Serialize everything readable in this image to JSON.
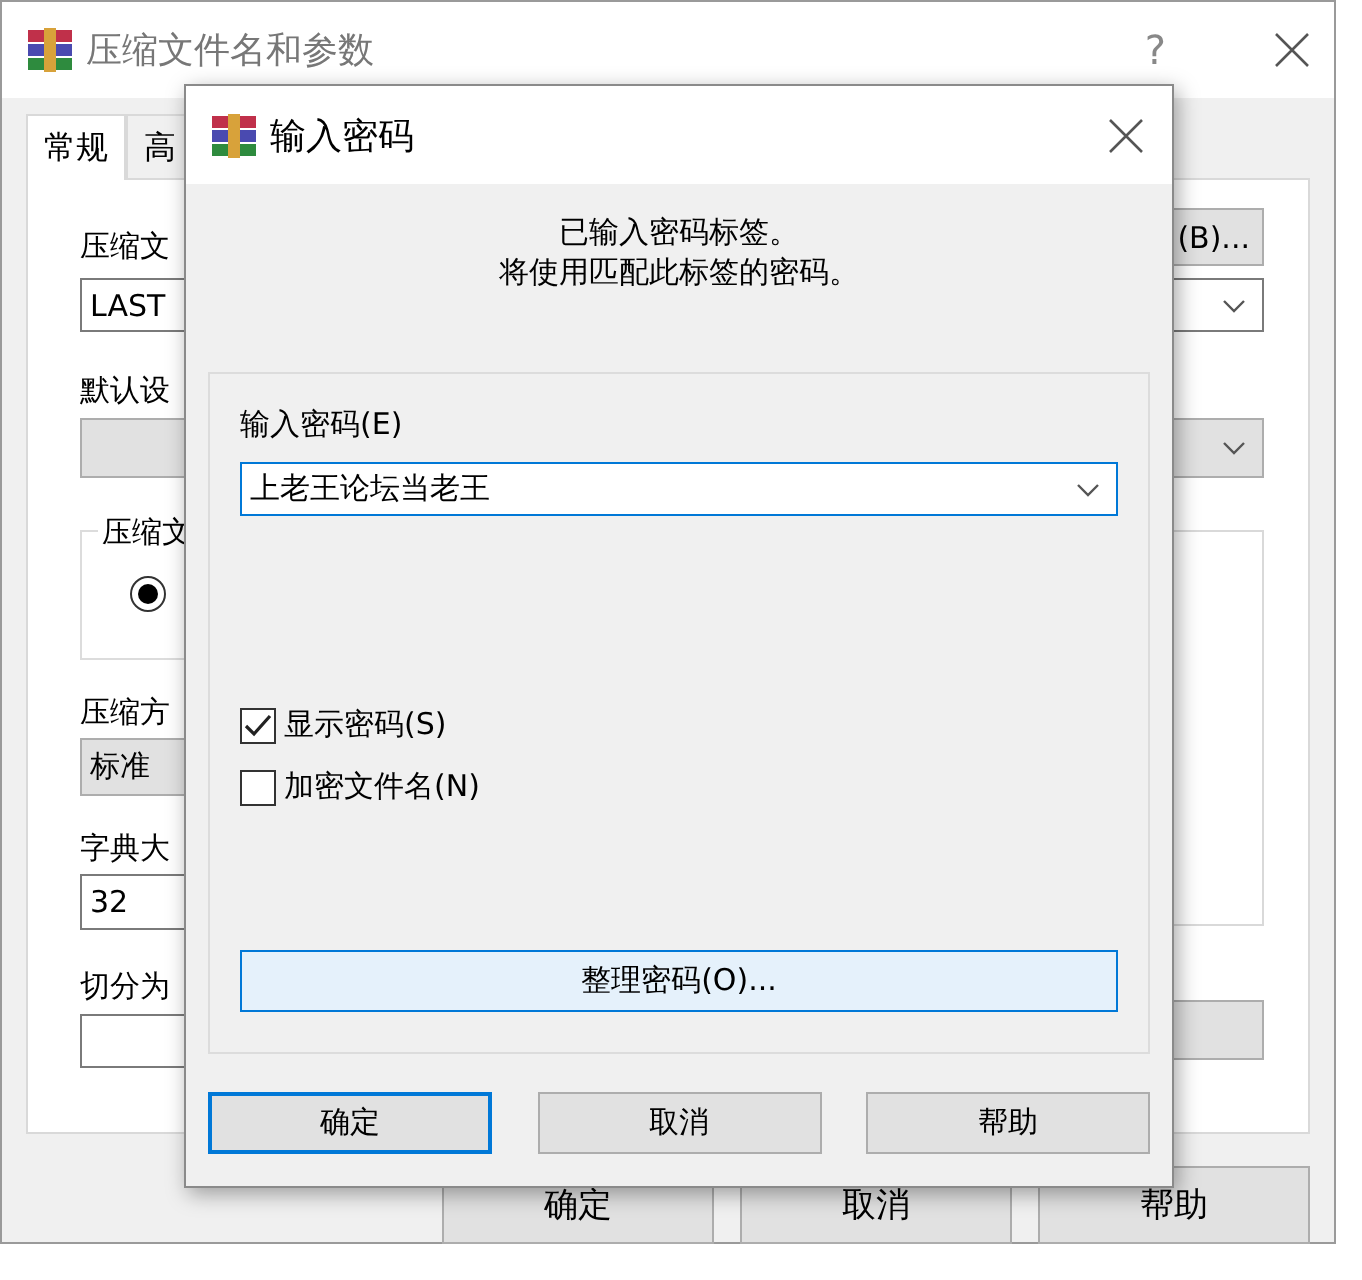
{
  "background_window": {
    "title": "压缩文件名和参数",
    "help_button": "?",
    "tabs": [
      {
        "label": "常规",
        "selected": true
      },
      {
        "label": "高",
        "selected": false
      }
    ],
    "archive_name_label": "压缩文",
    "archive_name": "LAST",
    "browse_button": "(B)...",
    "profile_label": "默认设",
    "group_label": "压缩文",
    "radio": {
      "selected": true
    },
    "method_label": "压缩方",
    "method": "标准",
    "dictionary_label": "字典大",
    "dictionary": "32",
    "split_label": "切分为",
    "buttons": [
      "确定",
      "取消",
      "帮助"
    ]
  },
  "dialog": {
    "title": "输入密码",
    "message_lines": [
      "已输入密码标签。",
      "将使用匹配此标签的密码。"
    ],
    "password_label": "输入密码(E)",
    "password": "上老王论坛当老王",
    "checkboxes": [
      {
        "label": "显示密码(S)",
        "checked": true
      },
      {
        "label": "加密文件名(N)",
        "checked": false
      }
    ],
    "organize_button": "整理密码(O)...",
    "buttons": [
      {
        "label": "确定",
        "focused": true
      },
      {
        "label": "取消",
        "focused": false
      },
      {
        "label": "帮助",
        "focused": false
      }
    ]
  }
}
